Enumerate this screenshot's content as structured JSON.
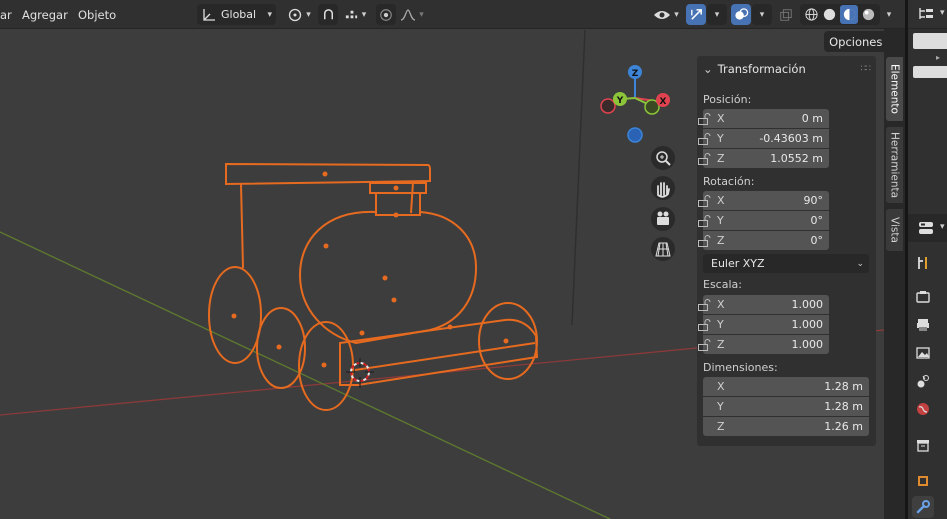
{
  "header": {
    "menus": [
      "ar",
      "Agregar",
      "Objeto"
    ],
    "orientation_label": "Global",
    "icons": [
      "transform-orientation-icon",
      "pivot-point-icon",
      "snap-icon",
      "snap-increment-icon",
      "proportional-editing-icon",
      "falloff-icon",
      "visibility-icon",
      "gizmo-icon",
      "overlays-icon",
      "xray-icon",
      "shading-wireframe-icon",
      "shading-solid-icon",
      "shading-material-icon",
      "shading-rendered-icon"
    ]
  },
  "viewport": {
    "opciones_label": "Opciones",
    "gizmo": {
      "z": "Z",
      "y": "Y",
      "x": "X"
    },
    "nav_icons": [
      "zoom-icon",
      "hand-pan-icon",
      "camera-icon",
      "grid-perspective-icon"
    ]
  },
  "npanel": {
    "title": "Transformación",
    "position_label": "Posición:",
    "position": [
      {
        "axis": "X",
        "value": "0 m"
      },
      {
        "axis": "Y",
        "value": "-0.43603 m"
      },
      {
        "axis": "Z",
        "value": "1.0552 m"
      }
    ],
    "rotation_label": "Rotación:",
    "rotation": [
      {
        "axis": "X",
        "value": "90°"
      },
      {
        "axis": "Y",
        "value": "0°"
      },
      {
        "axis": "Z",
        "value": "0°"
      }
    ],
    "rotation_mode": "Euler XYZ",
    "scale_label": "Escala:",
    "scale": [
      {
        "axis": "X",
        "value": "1.000"
      },
      {
        "axis": "Y",
        "value": "1.000"
      },
      {
        "axis": "Z",
        "value": "1.000"
      }
    ],
    "dimensions_label": "Dimensiones:",
    "dimensions": [
      {
        "axis": "X",
        "value": "1.28 m"
      },
      {
        "axis": "Y",
        "value": "1.28 m"
      },
      {
        "axis": "Z",
        "value": "1.26 m"
      }
    ]
  },
  "tabs": {
    "elemento": "Elemento",
    "herramienta": "Herramienta",
    "vista": "Vista"
  },
  "colors": {
    "selection": "#e66a1f",
    "accent": "#4772b3",
    "x_axis": "#e0434f",
    "y_axis": "#8cc43a",
    "z_axis": "#3c85d9"
  }
}
